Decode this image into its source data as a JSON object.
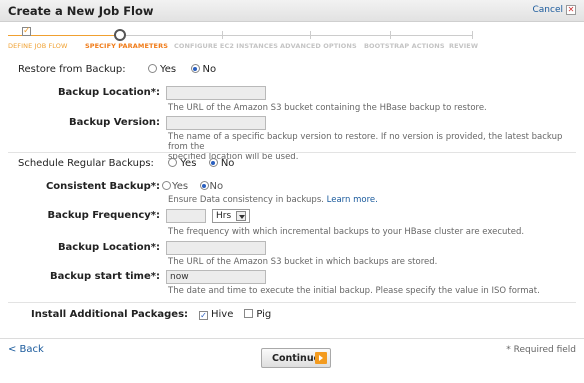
{
  "dialog": {
    "title": "Create a New Job Flow",
    "cancel_label": "Cancel"
  },
  "steps": [
    {
      "label": "DEFINE JOB FLOW",
      "state": "done"
    },
    {
      "label": "SPECIFY PARAMETERS",
      "state": "active"
    },
    {
      "label": "CONFIGURE EC2 INSTANCES",
      "state": "upcoming"
    },
    {
      "label": "ADVANCED OPTIONS",
      "state": "upcoming"
    },
    {
      "label": "BOOTSTRAP ACTIONS",
      "state": "upcoming"
    },
    {
      "label": "REVIEW",
      "state": "upcoming"
    }
  ],
  "restore": {
    "label": "Restore from Backup:",
    "yes": "Yes",
    "no": "No",
    "selected": "No",
    "location_label": "Backup Location*:",
    "location_value": "",
    "location_help": "The URL of the Amazon S3 bucket containing the HBase backup to restore.",
    "version_label": "Backup Version:",
    "version_value": "",
    "version_help_1": "The name of a specific backup version to restore. If no version is provided, the latest backup from the",
    "version_help_2": "specified location will be used."
  },
  "schedule": {
    "label": "Schedule Regular Backups:",
    "yes": "Yes",
    "no": "No",
    "selected": "No",
    "consistent_label": "Consistent Backup*:",
    "consistent_yes": "Yes",
    "consistent_no": "No",
    "consistent_selected": "No",
    "consistent_help": "Ensure Data consistency in backups.",
    "learn_more": "Learn more.",
    "frequency_label": "Backup Frequency*:",
    "frequency_value": "",
    "frequency_unit": "Hrs",
    "frequency_help": "The frequency with which incremental backups to your HBase cluster are executed.",
    "location_label": "Backup Location*:",
    "location_value": "",
    "location_help": "The URL of the Amazon S3 bucket in which backups are stored.",
    "start_label": "Backup start time*:",
    "start_value": "now",
    "start_help": "The date and time to execute the initial backup. Please specify the value in ISO format."
  },
  "packages": {
    "label": "Install Additional Packages:",
    "hive": "Hive",
    "hive_checked": true,
    "pig": "Pig",
    "pig_checked": false
  },
  "footer": {
    "back_label": "< Back",
    "continue_label": "Continue",
    "required_note": "* Required field"
  },
  "colors": {
    "accent": "#f07c1a",
    "link": "#1a5a9c",
    "radio": "#2a5fbf"
  }
}
